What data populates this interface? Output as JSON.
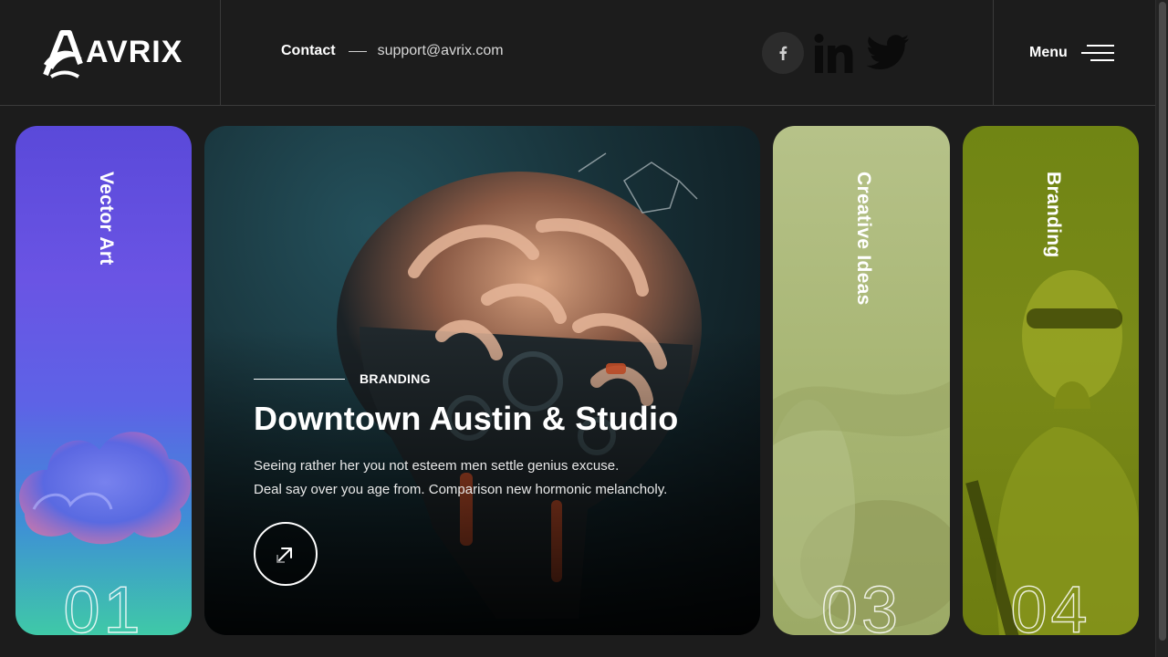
{
  "header": {
    "logo_text": "AVRIX",
    "contact_label": "Contact",
    "contact_email": "support@avrix.com",
    "socials": [
      {
        "name": "facebook",
        "icon": "facebook-icon"
      },
      {
        "name": "linkedin",
        "icon": "linkedin-icon"
      },
      {
        "name": "twitter",
        "icon": "twitter-icon"
      }
    ],
    "menu_label": "Menu"
  },
  "cards": [
    {
      "title": "Vector Art",
      "number": "01",
      "color": "#5a49d9"
    },
    {
      "category": "BRANDING",
      "title": "Downtown Austin & Studio",
      "description_line1": "Seeing rather her you not esteem men settle genius excuse.",
      "description_line2": "Deal say over you age from. Comparison new hormonic melancholy."
    },
    {
      "title": "Creative Ideas",
      "number": "03",
      "color": "#a8b674"
    },
    {
      "title": "Branding",
      "number": "04",
      "color": "#748816"
    }
  ]
}
